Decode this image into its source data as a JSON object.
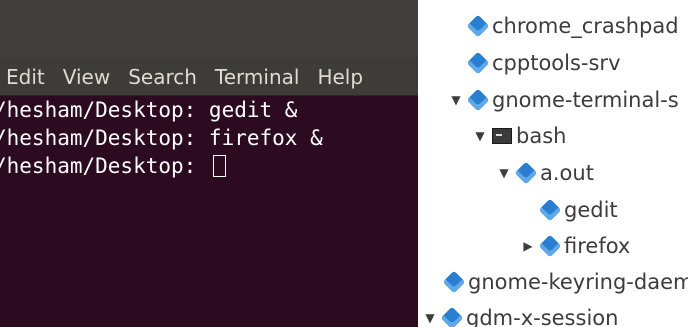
{
  "terminal": {
    "menu": [
      "Edit",
      "View",
      "Search",
      "Terminal",
      "Help"
    ],
    "lines": [
      "/hesham/Desktop: gedit &",
      "/hesham/Desktop: firefox &",
      "/hesham/Desktop: "
    ]
  },
  "process_tree": {
    "rows": [
      {
        "label": "chrome_crashpad",
        "icon": "process-icon",
        "expander": "none"
      },
      {
        "label": "cpptools-srv",
        "icon": "process-icon",
        "expander": "none"
      },
      {
        "label": "gnome-terminal-s",
        "icon": "process-icon",
        "expander": "expanded"
      },
      {
        "label": "bash",
        "icon": "terminal-icon",
        "expander": "expanded"
      },
      {
        "label": "a.out",
        "icon": "process-icon",
        "expander": "expanded"
      },
      {
        "label": "gedit",
        "icon": "process-icon",
        "expander": "none"
      },
      {
        "label": "firefox",
        "icon": "process-icon",
        "expander": "collapsed"
      },
      {
        "label": "gnome-keyring-daem",
        "icon": "process-icon",
        "expander": "none"
      },
      {
        "label": "gdm-x-session",
        "icon": "process-icon",
        "expander": "expanded"
      }
    ]
  }
}
